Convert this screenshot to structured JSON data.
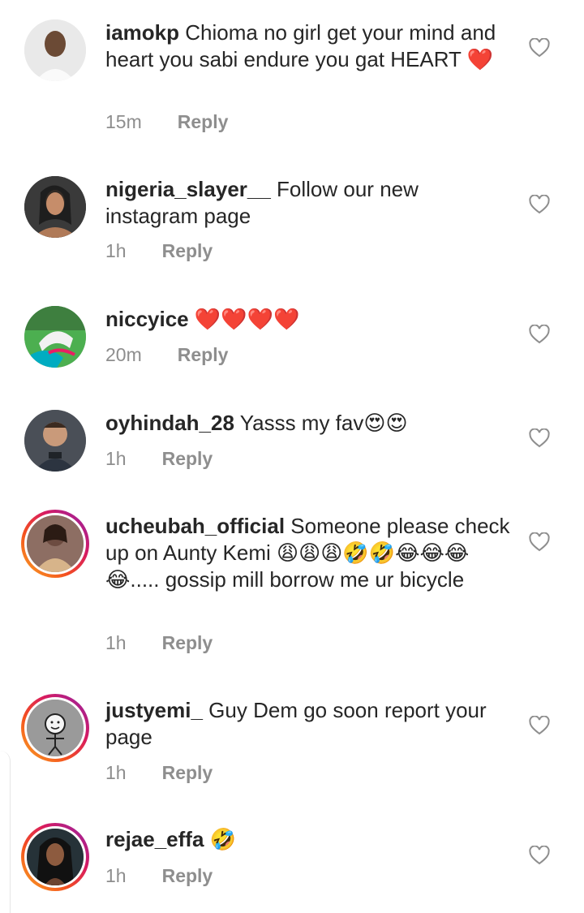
{
  "comments": [
    {
      "username": "iamokp",
      "text": " Chioma no girl get your mind and heart you sabi endure you gat HEART ❤️",
      "time": "15m",
      "reply": "Reply"
    },
    {
      "username": "nigeria_slayer__",
      "text": " Follow our new instagram page",
      "time": "1h",
      "reply": "Reply"
    },
    {
      "username": "niccyice",
      "text": " ❤️❤️❤️❤️",
      "time": "20m",
      "reply": "Reply"
    },
    {
      "username": "oyhindah_28",
      "text": " Yasss my fav😍😍",
      "time": "1h",
      "reply": "Reply"
    },
    {
      "username": "ucheubah_official",
      "text": " Someone please check up on Aunty Kemi 😩😩😩🤣🤣😂😂😂😂..... gossip mill borrow me ur bicycle",
      "time": "1h",
      "reply": "Reply"
    },
    {
      "username": "justyemi_",
      "text": " Guy Dem go soon report your page",
      "time": "1h",
      "reply": "Reply"
    },
    {
      "username": "rejae_effa",
      "text": " 🤣",
      "time": "1h",
      "reply": "Reply"
    }
  ],
  "icons": {
    "like": "heart-outline-icon"
  },
  "colors": {
    "text": "#262626",
    "meta": "#8e8e8e",
    "heart_outline": "#8e8e8e"
  }
}
